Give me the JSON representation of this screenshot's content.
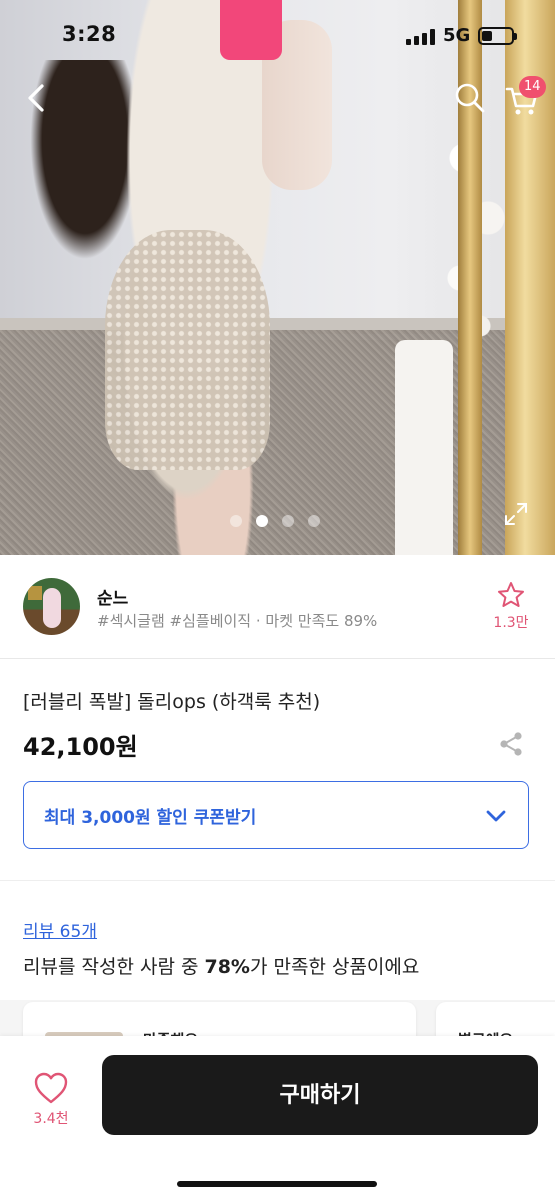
{
  "status_bar": {
    "time": "3:28",
    "network": "5G",
    "battery_level": 0.35
  },
  "hero": {
    "image_count": 4,
    "active_index": 1,
    "icons": {
      "back": "chevron-left-icon",
      "search": "search-icon",
      "cart": "cart-icon",
      "expand": "expand-icon"
    },
    "cart_badge": "14"
  },
  "seller": {
    "name": "순느",
    "tags": "#섹시글램 #심플베이직 · 마켓 만족도 89%",
    "follow_count": "1.3만"
  },
  "product": {
    "title": "[러블리 폭발] 돌리ops (하객룩 추천)",
    "price": "42,100원",
    "coupon_label": "최대 3,000원 할인 쿠폰받기"
  },
  "reviews": {
    "link_label": "리뷰 65개",
    "summary_prefix": "리뷰를 작성한 사람 중 ",
    "summary_percent": "78%",
    "summary_suffix": "가 만족한 상품이에요",
    "cards": [
      {
        "text": "만족해요"
      },
      {
        "text": "별로에요"
      }
    ]
  },
  "bottom_bar": {
    "like_count": "3.4천",
    "buy_label": "구매하기"
  },
  "colors": {
    "accent_blue": "#2f64dc",
    "accent_pink": "#e05575",
    "badge": "#f0506e",
    "buy_bg": "#1a1a1a"
  }
}
